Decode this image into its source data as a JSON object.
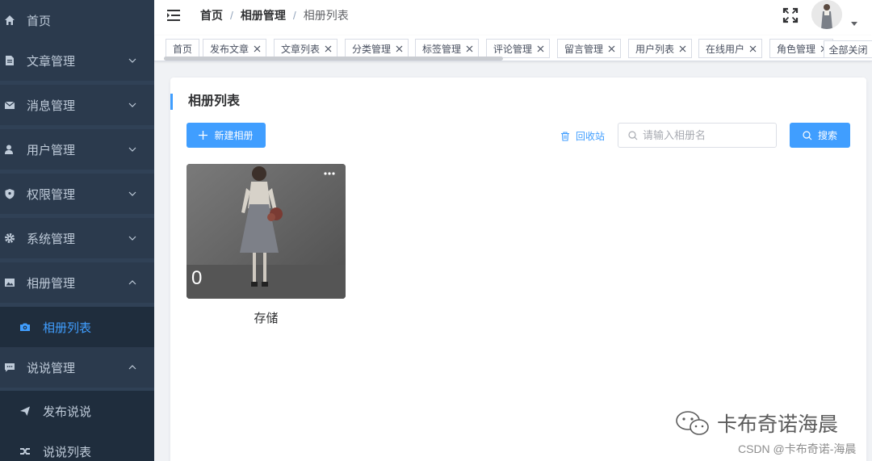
{
  "colors": {
    "sidebar_bg": "#304156",
    "accent": "#409eff",
    "sidebar_text": "#bfcbd9"
  },
  "sidebar": {
    "items": [
      {
        "label": "首页",
        "icon": "home-icon"
      },
      {
        "label": "文章管理",
        "icon": "document-icon",
        "expanded": false
      },
      {
        "label": "消息管理",
        "icon": "mail-icon",
        "expanded": false
      },
      {
        "label": "用户管理",
        "icon": "user-icon",
        "expanded": false
      },
      {
        "label": "权限管理",
        "icon": "shield-icon",
        "expanded": false
      },
      {
        "label": "系统管理",
        "icon": "gear-icon",
        "expanded": false
      },
      {
        "label": "相册管理",
        "icon": "picture-icon",
        "expanded": true
      },
      {
        "label": "说说管理",
        "icon": "chat-icon",
        "expanded": true
      }
    ],
    "sub_items": [
      {
        "label": "相册列表",
        "icon": "camera-icon",
        "active": true
      },
      {
        "label": "发布说说",
        "icon": "send-icon",
        "active": false
      },
      {
        "label": "说说列表",
        "icon": "shuffle-icon",
        "active": false
      }
    ]
  },
  "header": {
    "breadcrumb": [
      "首页",
      "相册管理",
      "相册列表"
    ],
    "separator": "/"
  },
  "tags": {
    "items": [
      "首页",
      "发布文章",
      "文章列表",
      "分类管理",
      "标签管理",
      "评论管理",
      "留言管理",
      "用户列表",
      "在线用户",
      "角色管理"
    ],
    "close_all": "全部关闭"
  },
  "main": {
    "title": "相册列表",
    "new_button": "新建相册",
    "recycle_label": "回收站",
    "search_placeholder": "请输入相册名",
    "search_button": "搜索",
    "albums": [
      {
        "name": "存储",
        "count": "0"
      }
    ]
  },
  "watermark": {
    "account": "卡布奇诺海晨",
    "csdn": "CSDN @卡布奇诺-海晨"
  }
}
